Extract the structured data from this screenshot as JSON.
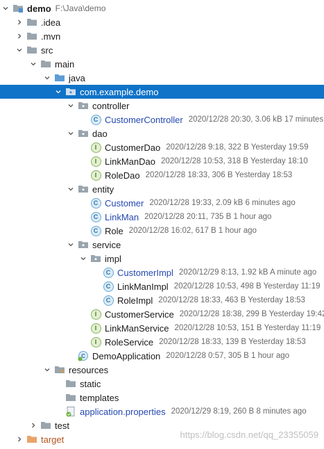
{
  "colors": {
    "selection": "#0f73c8",
    "folder": "#9aa4ad",
    "package_folder": "#7fa9c9",
    "excluded_folder": "#e9a46b",
    "class_badge": "#2f73a8",
    "interface_badge": "#4f7d20"
  },
  "project": {
    "name": "demo",
    "path": "F:\\Java\\demo"
  },
  "nodes": {
    "idea": {
      "label": ".idea"
    },
    "mvn": {
      "label": ".mvn"
    },
    "src": {
      "label": "src"
    },
    "main": {
      "label": "main"
    },
    "java": {
      "label": "java"
    },
    "pkg": {
      "label": "com.example.demo"
    },
    "controller": {
      "label": "controller"
    },
    "customer_controller": {
      "label": "CustomerController",
      "meta": "2020/12/28 20:30, 3.06 kB 17 minutes"
    },
    "dao": {
      "label": "dao"
    },
    "customer_dao": {
      "label": "CustomerDao",
      "meta": "2020/12/28 9:18, 322 B Yesterday 19:59"
    },
    "linkman_dao": {
      "label": "LinkManDao",
      "meta": "2020/12/28 10:53, 318 B Yesterday 18:10"
    },
    "role_dao": {
      "label": "RoleDao",
      "meta": "2020/12/28 18:33, 306 B Yesterday 18:53"
    },
    "entity": {
      "label": "entity"
    },
    "customer": {
      "label": "Customer",
      "meta": "2020/12/28 19:33, 2.09 kB 6 minutes ago"
    },
    "linkman": {
      "label": "LinkMan",
      "meta": "2020/12/28 20:11, 735 B 1 hour ago"
    },
    "role": {
      "label": "Role",
      "meta": "2020/12/28 16:02, 617 B 1 hour ago"
    },
    "service": {
      "label": "service"
    },
    "impl": {
      "label": "impl"
    },
    "customer_impl": {
      "label": "CustomerImpl",
      "meta": "2020/12/29 8:13, 1.92 kB A minute ago"
    },
    "linkman_impl": {
      "label": "LinkManImpl",
      "meta": "2020/12/28 10:53, 498 B Yesterday 11:19"
    },
    "role_impl": {
      "label": "RoleImpl",
      "meta": "2020/12/28 18:33, 463 B Yesterday 18:53"
    },
    "customer_service": {
      "label": "CustomerService",
      "meta": "2020/12/28 18:38, 299 B Yesterday 19:42"
    },
    "linkman_service": {
      "label": "LinkManService",
      "meta": "2020/12/28 10:53, 151 B Yesterday 11:19"
    },
    "role_service": {
      "label": "RoleService",
      "meta": "2020/12/28 18:33, 139 B Yesterday 18:53"
    },
    "demo_application": {
      "label": "DemoApplication",
      "meta": "2020/12/28 0:57, 305 B 1 hour ago"
    },
    "resources": {
      "label": "resources"
    },
    "static": {
      "label": "static"
    },
    "templates": {
      "label": "templates"
    },
    "app_props": {
      "label": "application.properties",
      "meta": "2020/12/29 8:19, 260 B 8 minutes ago"
    },
    "test": {
      "label": "test"
    },
    "target": {
      "label": "target"
    }
  },
  "badges": {
    "class": "C",
    "interface": "I"
  },
  "watermark": "https://blog.csdn.net/qq_23355059"
}
